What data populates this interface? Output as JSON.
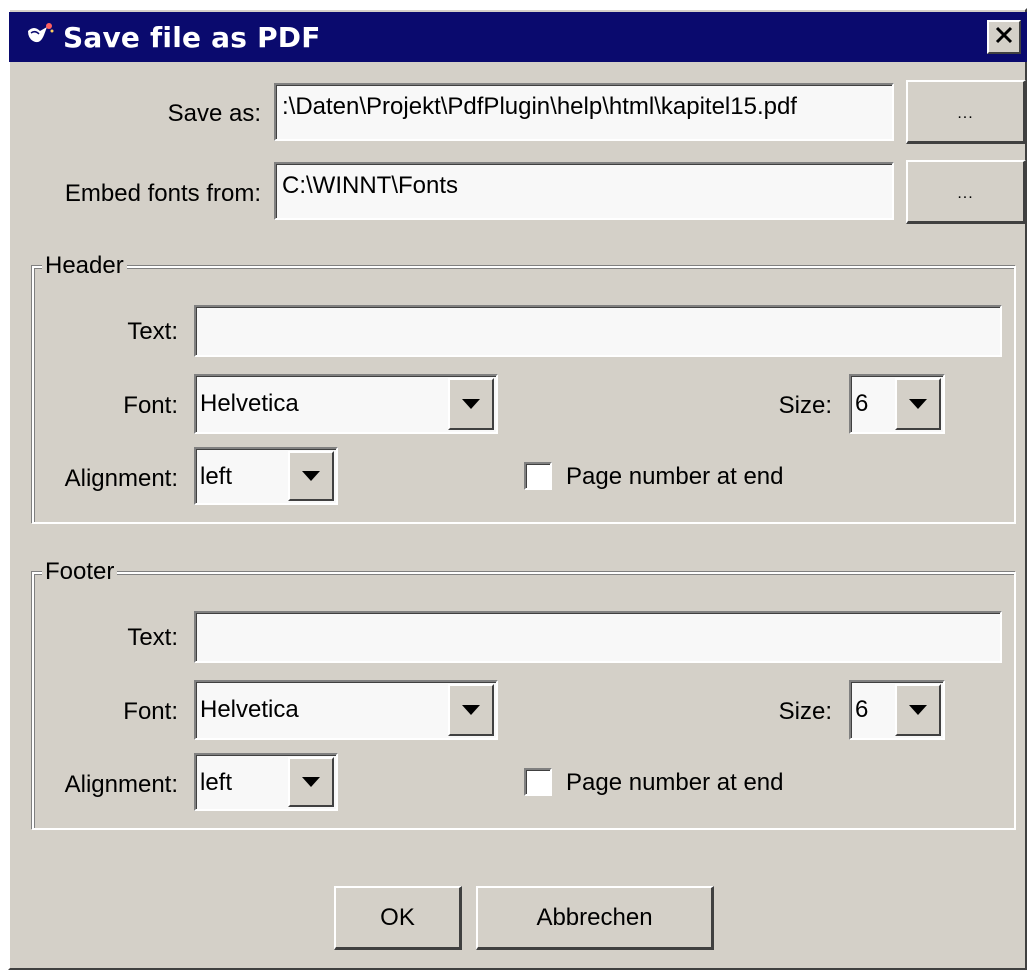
{
  "window": {
    "title": "Save file as PDF",
    "close_glyph": "✕",
    "icon": "pdf-plugin-icon"
  },
  "save_as": {
    "label": "Save as:",
    "value": ":\\Daten\\Projekt\\PdfPlugin\\help\\html\\kapitel15.pdf",
    "browse_label": "..."
  },
  "embed_fonts": {
    "label": "Embed fonts from:",
    "value": "C:\\WINNT\\Fonts",
    "browse_label": "..."
  },
  "header": {
    "legend": "Header",
    "text_label": "Text:",
    "text_value": "",
    "font_label": "Font:",
    "font_value": "Helvetica",
    "size_label": "Size:",
    "size_value": "6",
    "alignment_label": "Alignment:",
    "alignment_value": "left",
    "page_number_label": "Page number at end",
    "page_number_checked": false
  },
  "footer": {
    "legend": "Footer",
    "text_label": "Text:",
    "text_value": "",
    "font_label": "Font:",
    "font_value": "Helvetica",
    "size_label": "Size:",
    "size_value": "6",
    "alignment_label": "Alignment:",
    "alignment_value": "left",
    "page_number_label": "Page number at end",
    "page_number_checked": false
  },
  "buttons": {
    "ok_label": "OK",
    "cancel_label": "Abbrechen"
  },
  "colors": {
    "titlebar": "#0a0a6e",
    "face": "#d4d0c8",
    "field": "#f8f8f8"
  }
}
